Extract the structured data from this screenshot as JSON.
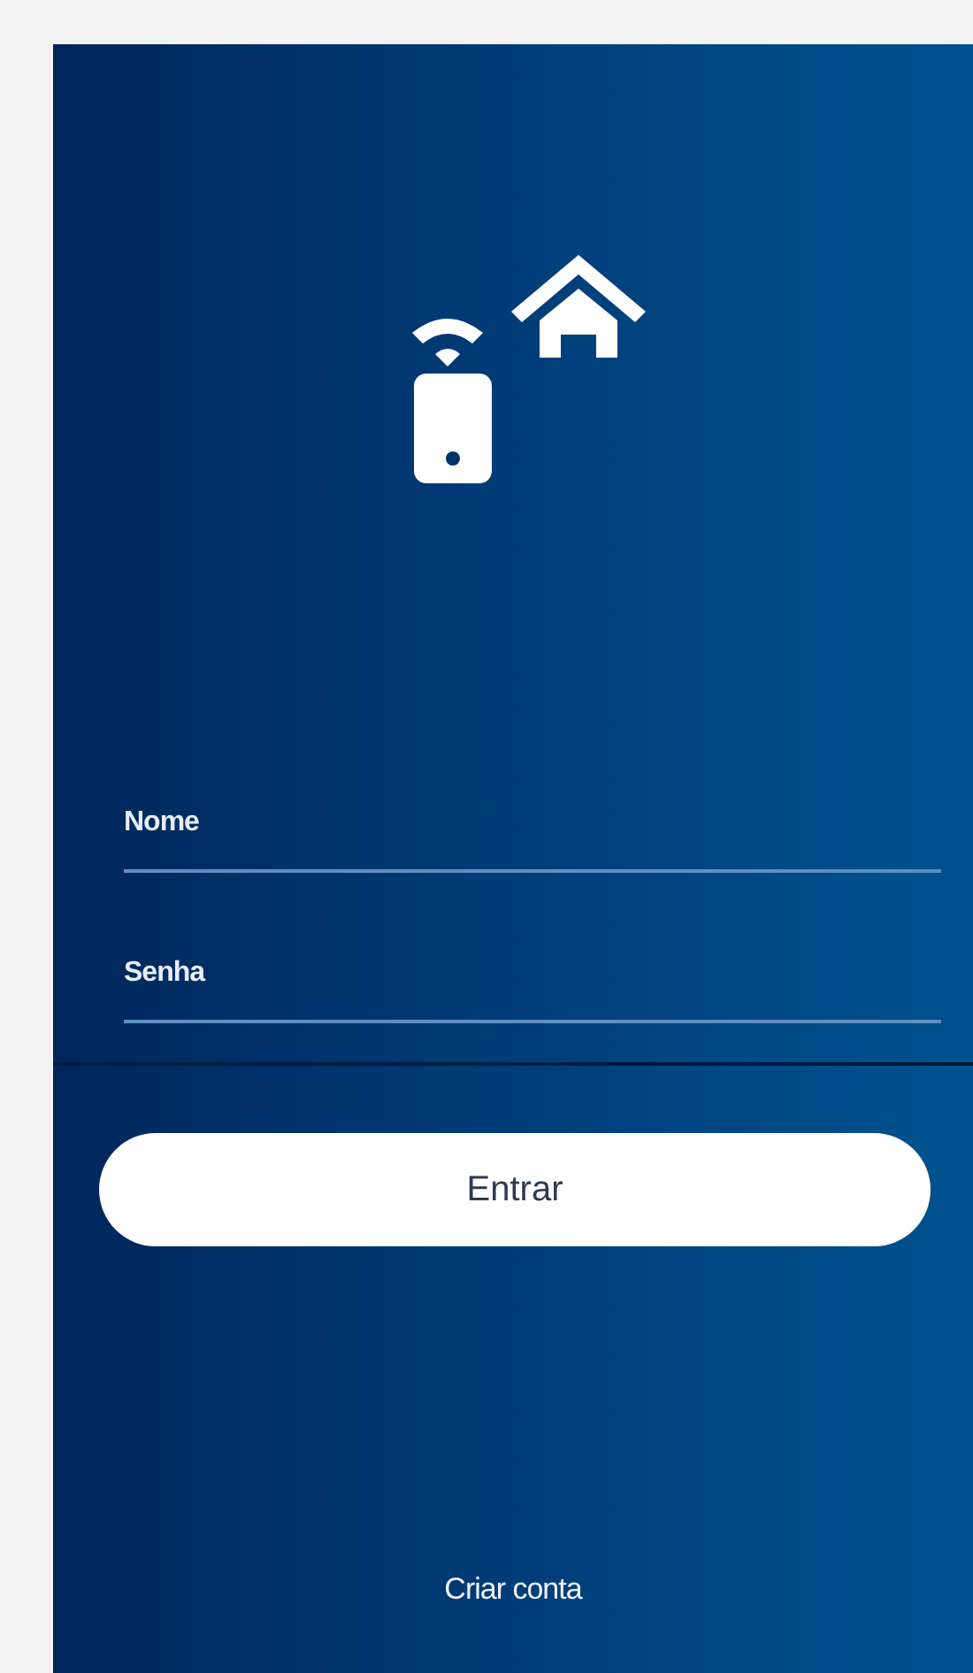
{
  "fields": [
    {
      "placeholder": "Nome"
    },
    {
      "placeholder": "Senha"
    }
  ],
  "login_button": {
    "label": "Entrar"
  },
  "create_account_link": {
    "label": "Criar conta"
  }
}
